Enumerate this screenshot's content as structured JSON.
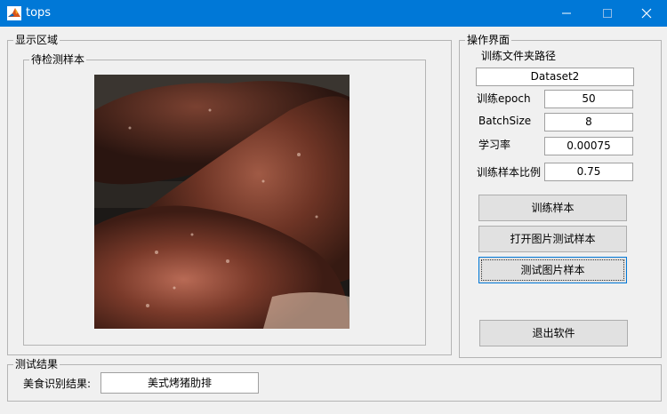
{
  "window": {
    "title": "tops"
  },
  "display_area": {
    "title": "显示区域",
    "sample_panel": {
      "title": "待检测样本"
    }
  },
  "operation_panel": {
    "title": "操作界面",
    "path_label": "训练文件夹路径",
    "path_value": "Dataset2",
    "epoch_label": "训练epoch",
    "epoch_value": "50",
    "batch_label": "BatchSize",
    "batch_value": "8",
    "lr_label": "学习率",
    "lr_value": "0.00075",
    "ratio_label": "训练样本比例",
    "ratio_value": "0.75",
    "train_button": "训练样本",
    "open_test_button": "打开图片测试样本",
    "test_button": "测试图片样本",
    "exit_button": "退出软件"
  },
  "results": {
    "title": "测试结果",
    "food_label": "美食识别结果:",
    "food_value": "美式烤猪肋排"
  }
}
